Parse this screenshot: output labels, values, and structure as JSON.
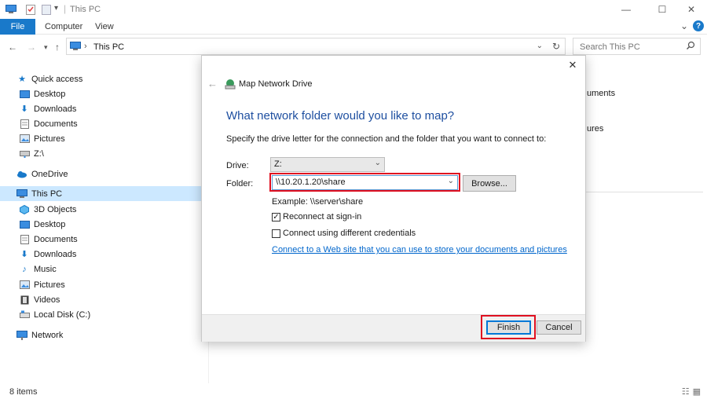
{
  "window": {
    "title": "This PC",
    "minimize": "—",
    "maximize": "☐",
    "close": "✕"
  },
  "ribbon": {
    "tabs": [
      "File",
      "Computer",
      "View"
    ],
    "collapse": "⌄",
    "help": "?"
  },
  "address": {
    "path": "This PC",
    "separator": "›",
    "search_placeholder": "Search This PC"
  },
  "sidebar": {
    "items": [
      {
        "label": "Quick access",
        "icon": "star-icon"
      },
      {
        "label": "Desktop",
        "icon": "desktop-icon"
      },
      {
        "label": "Downloads",
        "icon": "download-icon"
      },
      {
        "label": "Documents",
        "icon": "documents-icon"
      },
      {
        "label": "Pictures",
        "icon": "pictures-icon"
      },
      {
        "label": "Z:\\",
        "icon": "network-drive-icon"
      },
      {
        "label": "OneDrive",
        "icon": "cloud-icon"
      },
      {
        "label": "This PC",
        "icon": "computer-icon"
      },
      {
        "label": "3D Objects",
        "icon": "cube-icon"
      },
      {
        "label": "Desktop",
        "icon": "desktop-icon"
      },
      {
        "label": "Documents",
        "icon": "documents-icon"
      },
      {
        "label": "Downloads",
        "icon": "download-icon"
      },
      {
        "label": "Music",
        "icon": "music-icon"
      },
      {
        "label": "Pictures",
        "icon": "pictures-icon"
      },
      {
        "label": "Videos",
        "icon": "video-icon"
      },
      {
        "label": "Local Disk (C:)",
        "icon": "disk-icon"
      },
      {
        "label": "Network",
        "icon": "network-icon"
      }
    ]
  },
  "background": {
    "frag1": "uments",
    "frag2": "ures"
  },
  "status": {
    "items": "8 items"
  },
  "dialog": {
    "title": "Map Network Drive",
    "heading": "What network folder would you like to map?",
    "description": "Specify the drive letter for the connection and the folder that you want to connect to:",
    "drive_label": "Drive:",
    "drive_value": "Z:",
    "folder_label": "Folder:",
    "folder_value": "\\\\10.20.1.20\\share",
    "browse": "Browse...",
    "example": "Example: \\\\server\\share",
    "reconnect": "Reconnect at sign-in",
    "reconnect_checked": true,
    "different_credentials": "Connect using different credentials",
    "different_credentials_checked": false,
    "link": "Connect to a Web site that you can use to store your documents and pictures",
    "link_suffix": ".",
    "finish": "Finish",
    "cancel": "Cancel"
  },
  "colors": {
    "accent": "#1979ca",
    "highlight": "#e01020",
    "heading": "#1e4fa0",
    "link": "#0066cc"
  }
}
